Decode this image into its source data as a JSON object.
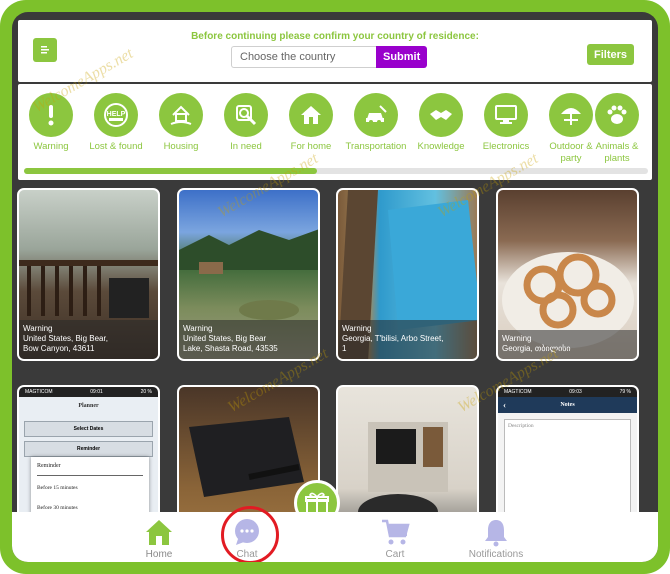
{
  "header": {
    "confirm_text": "Before continuing please confirm your country of residence:",
    "country_placeholder": "Choose the country",
    "submit_label": "Submit",
    "filters_label": "Filters"
  },
  "categories": [
    {
      "label": "Warning",
      "icon": "exclamation-icon"
    },
    {
      "label": "Lost & found",
      "icon": "help-icon"
    },
    {
      "label": "Housing",
      "icon": "house-hand-icon"
    },
    {
      "label": "In need",
      "icon": "search-person-icon"
    },
    {
      "label": "For home",
      "icon": "home-icon"
    },
    {
      "label": "Transportation",
      "icon": "car-wrench-icon"
    },
    {
      "label": "Knowledge",
      "icon": "handshake-icon"
    },
    {
      "label": "Electronics",
      "icon": "monitor-icon"
    },
    {
      "label": "Outdoor & party",
      "icon": "umbrella-table-icon"
    },
    {
      "label": "Animals & plants",
      "icon": "paw-icon"
    }
  ],
  "category_scroll_fraction": 0.47,
  "listings": [
    {
      "category": "Warning",
      "location": "United States, Big Bear,",
      "location2": "Bow Canyon, 43611"
    },
    {
      "category": "Warning",
      "location": "United States, Big Bear",
      "location2": "Lake, Shasta Road, 43535"
    },
    {
      "category": "Warning",
      "location": "Georgia, T'bilisi, Arbo Street,",
      "location2": "1"
    },
    {
      "category": "Warning",
      "location": "Georgia, თბილისი",
      "location2": ""
    }
  ],
  "phone_screens": {
    "status_carrier": "MAGTICOM",
    "left": {
      "time": "09:01",
      "battery": "20 %",
      "title": "Planner",
      "rows": [
        "Select Dates",
        "Reminder"
      ],
      "popup_title": "Reminder",
      "popup_items": [
        "Before 15 minutes",
        "Before 30 minutes"
      ]
    },
    "right": {
      "time": "09:03",
      "battery": "79 %",
      "title": "Notes",
      "placeholder": "Description"
    }
  },
  "watermark": "WelcomeApps.net",
  "nav": {
    "home": "Home",
    "chat": "Chat",
    "cart": "Cart",
    "notifications": "Notifications"
  },
  "colors": {
    "brand_green": "#8cc63f",
    "submit_purple": "#9900cc",
    "chat_highlight_red": "#e21b23"
  }
}
